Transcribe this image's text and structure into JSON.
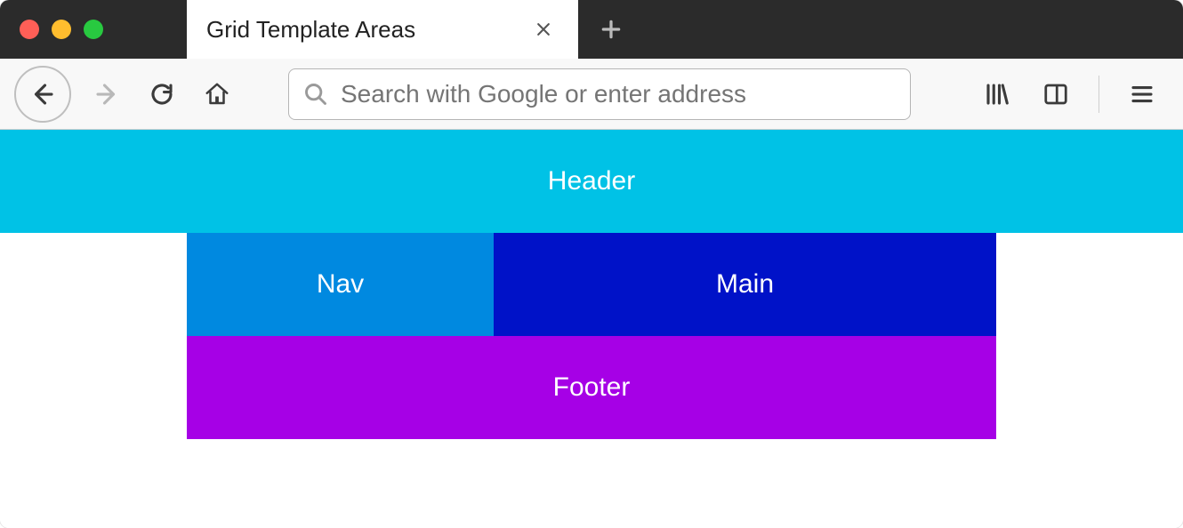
{
  "window": {
    "tab_title": "Grid Template Areas"
  },
  "toolbar": {
    "search_placeholder": "Search with Google or enter address"
  },
  "colors": {
    "header": "#00c2e6",
    "nav": "#0089e0",
    "main": "#0012c8",
    "footer": "#a600e6"
  },
  "content": {
    "header_label": "Header",
    "nav_label": "Nav",
    "main_label": "Main",
    "footer_label": "Footer"
  }
}
